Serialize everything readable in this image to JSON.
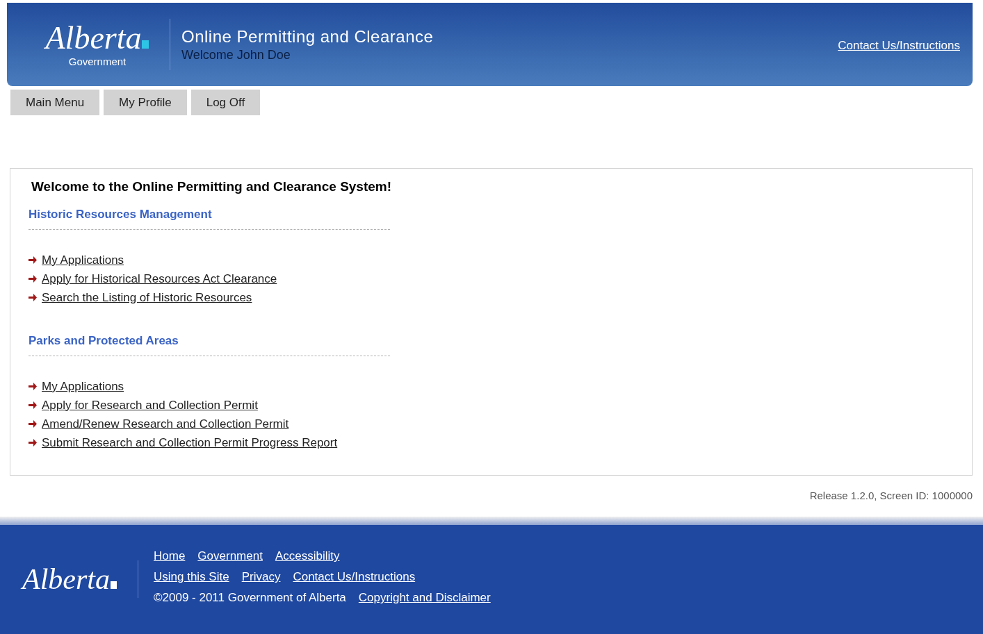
{
  "header": {
    "logo": {
      "wordmark": "Alberta",
      "subtitle": "Government"
    },
    "title": "Online Permitting and Clearance",
    "welcome": "Welcome John Doe",
    "contact_link": "Contact Us/Instructions"
  },
  "nav": [
    "Main Menu",
    "My Profile",
    "Log Off"
  ],
  "content": {
    "heading": "Welcome to the Online Permitting and Clearance System!",
    "sections": [
      {
        "title": "Historic Resources Management",
        "links": [
          "My Applications",
          "Apply for Historical Resources Act Clearance",
          "Search the Listing of Historic Resources"
        ]
      },
      {
        "title": "Parks and Protected Areas",
        "links": [
          "My Applications",
          "Apply for Research and Collection Permit",
          "Amend/Renew Research and Collection Permit",
          "Submit Research and Collection Permit Progress Report"
        ]
      }
    ]
  },
  "release": "Release 1.2.0, Screen ID: 1000000",
  "footer": {
    "wordmark": "Alberta",
    "link_rows": [
      [
        "Home",
        "Government",
        "Accessibility"
      ],
      [
        "Using this Site",
        "Privacy",
        "Contact Us/Instructions"
      ]
    ],
    "copyright": "©2009 - 2011 Government of Alberta",
    "copyright_link": "Copyright and Disclaimer"
  }
}
